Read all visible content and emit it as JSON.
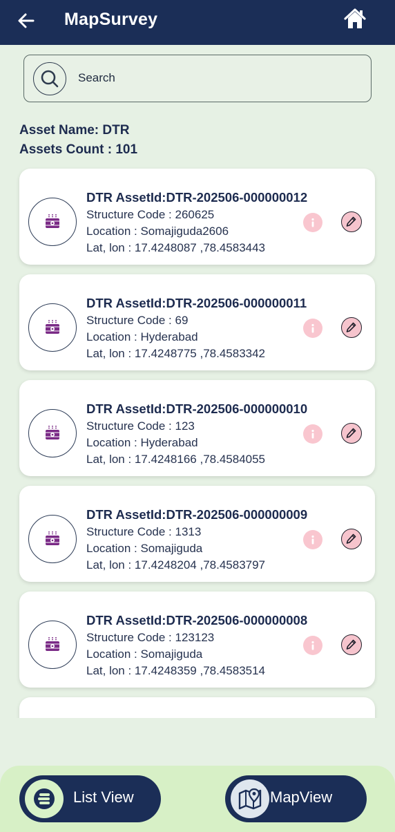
{
  "header": {
    "title": "MapSurvey",
    "back_icon": "arrow-left-icon",
    "home_icon": "home-icon"
  },
  "search": {
    "placeholder": "Search",
    "icon": "search-icon"
  },
  "summary": {
    "asset_name": "Asset Name: DTR",
    "assets_count": "Assets Count : 101"
  },
  "assets": [
    {
      "title": "DTR AssetId:DTR-202506-000000012",
      "structure_code": "Structure Code : 260625",
      "location": "Location : Somajiguda2606",
      "latlon": "Lat, lon : 17.4248087 ,78.4583443"
    },
    {
      "title": "DTR AssetId:DTR-202506-000000011",
      "structure_code": "Structure Code : 69",
      "location": "Location : Hyderabad",
      "latlon": "Lat, lon : 17.4248775 ,78.4583342"
    },
    {
      "title": "DTR AssetId:DTR-202506-000000010",
      "structure_code": "Structure Code : 123",
      "location": "Location : Hyderabad",
      "latlon": "Lat, lon : 17.4248166 ,78.4584055"
    },
    {
      "title": "DTR AssetId:DTR-202506-000000009",
      "structure_code": "Structure Code : 1313",
      "location": "Location : Somajiguda",
      "latlon": "Lat, lon : 17.4248204 ,78.4583797"
    },
    {
      "title": "DTR AssetId:DTR-202506-000000008",
      "structure_code": "Structure Code : 123123",
      "location": "Location : Somajiguda",
      "latlon": "Lat, lon : 17.4248359 ,78.4583514"
    }
  ],
  "bottom_nav": {
    "list_view_label": "List View",
    "map_view_label": "MapView",
    "list_view_icon": "list-icon",
    "map_view_icon": "map-pin-icon"
  },
  "colors": {
    "header_bg": "#1b2e57",
    "page_bg": "#e6f1e4",
    "card_bg": "#ffffff",
    "accent_pink": "#f9c6cf",
    "bottom_bar_bg": "#d7f0c6",
    "transformer_purple": "#7a2a86"
  }
}
